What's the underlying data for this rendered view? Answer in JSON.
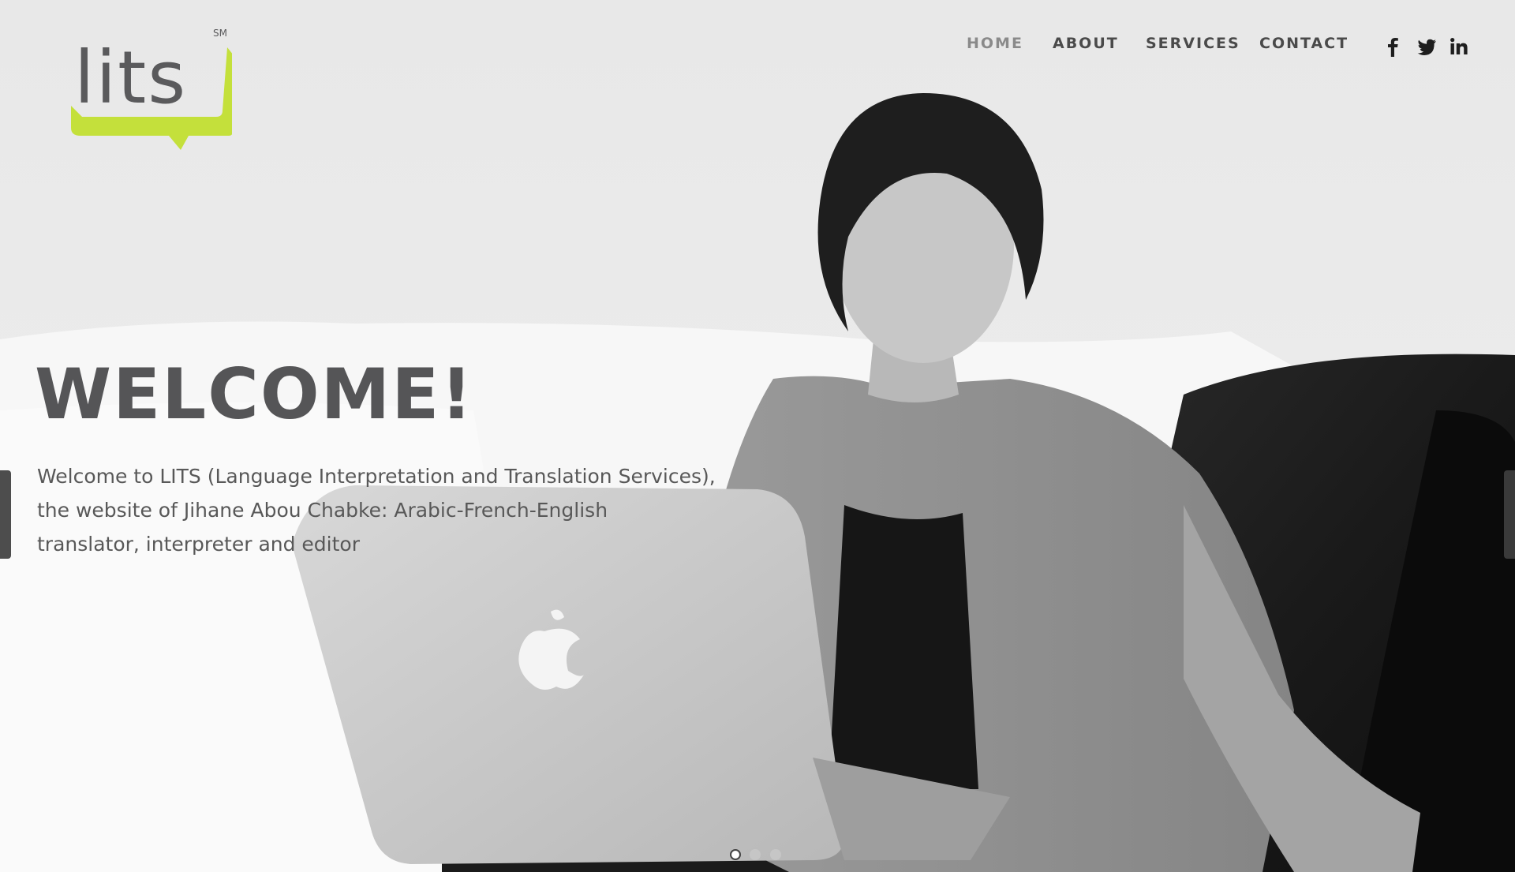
{
  "brand": {
    "logo_text": "lits",
    "logo_mark": "SM",
    "accent_color": "#c4e03b",
    "text_color": "#5a5a5c"
  },
  "nav": {
    "items": [
      {
        "label": "HOME",
        "active": true
      },
      {
        "label": "ABOUT",
        "active": false
      },
      {
        "label": "SERVICES",
        "active": false
      },
      {
        "label": "CONTACT",
        "active": false
      }
    ],
    "social": [
      {
        "icon": "facebook-icon"
      },
      {
        "icon": "twitter-icon"
      },
      {
        "icon": "linkedin-icon"
      }
    ]
  },
  "hero": {
    "title": "WELCOME!",
    "text": "Welcome to LITS (Language Interpretation and Translation Services), the website of Jihane Abou Chabke: Arabic-French-English translator, interpreter and editor",
    "slides_total": 3,
    "active_slide": 1
  }
}
